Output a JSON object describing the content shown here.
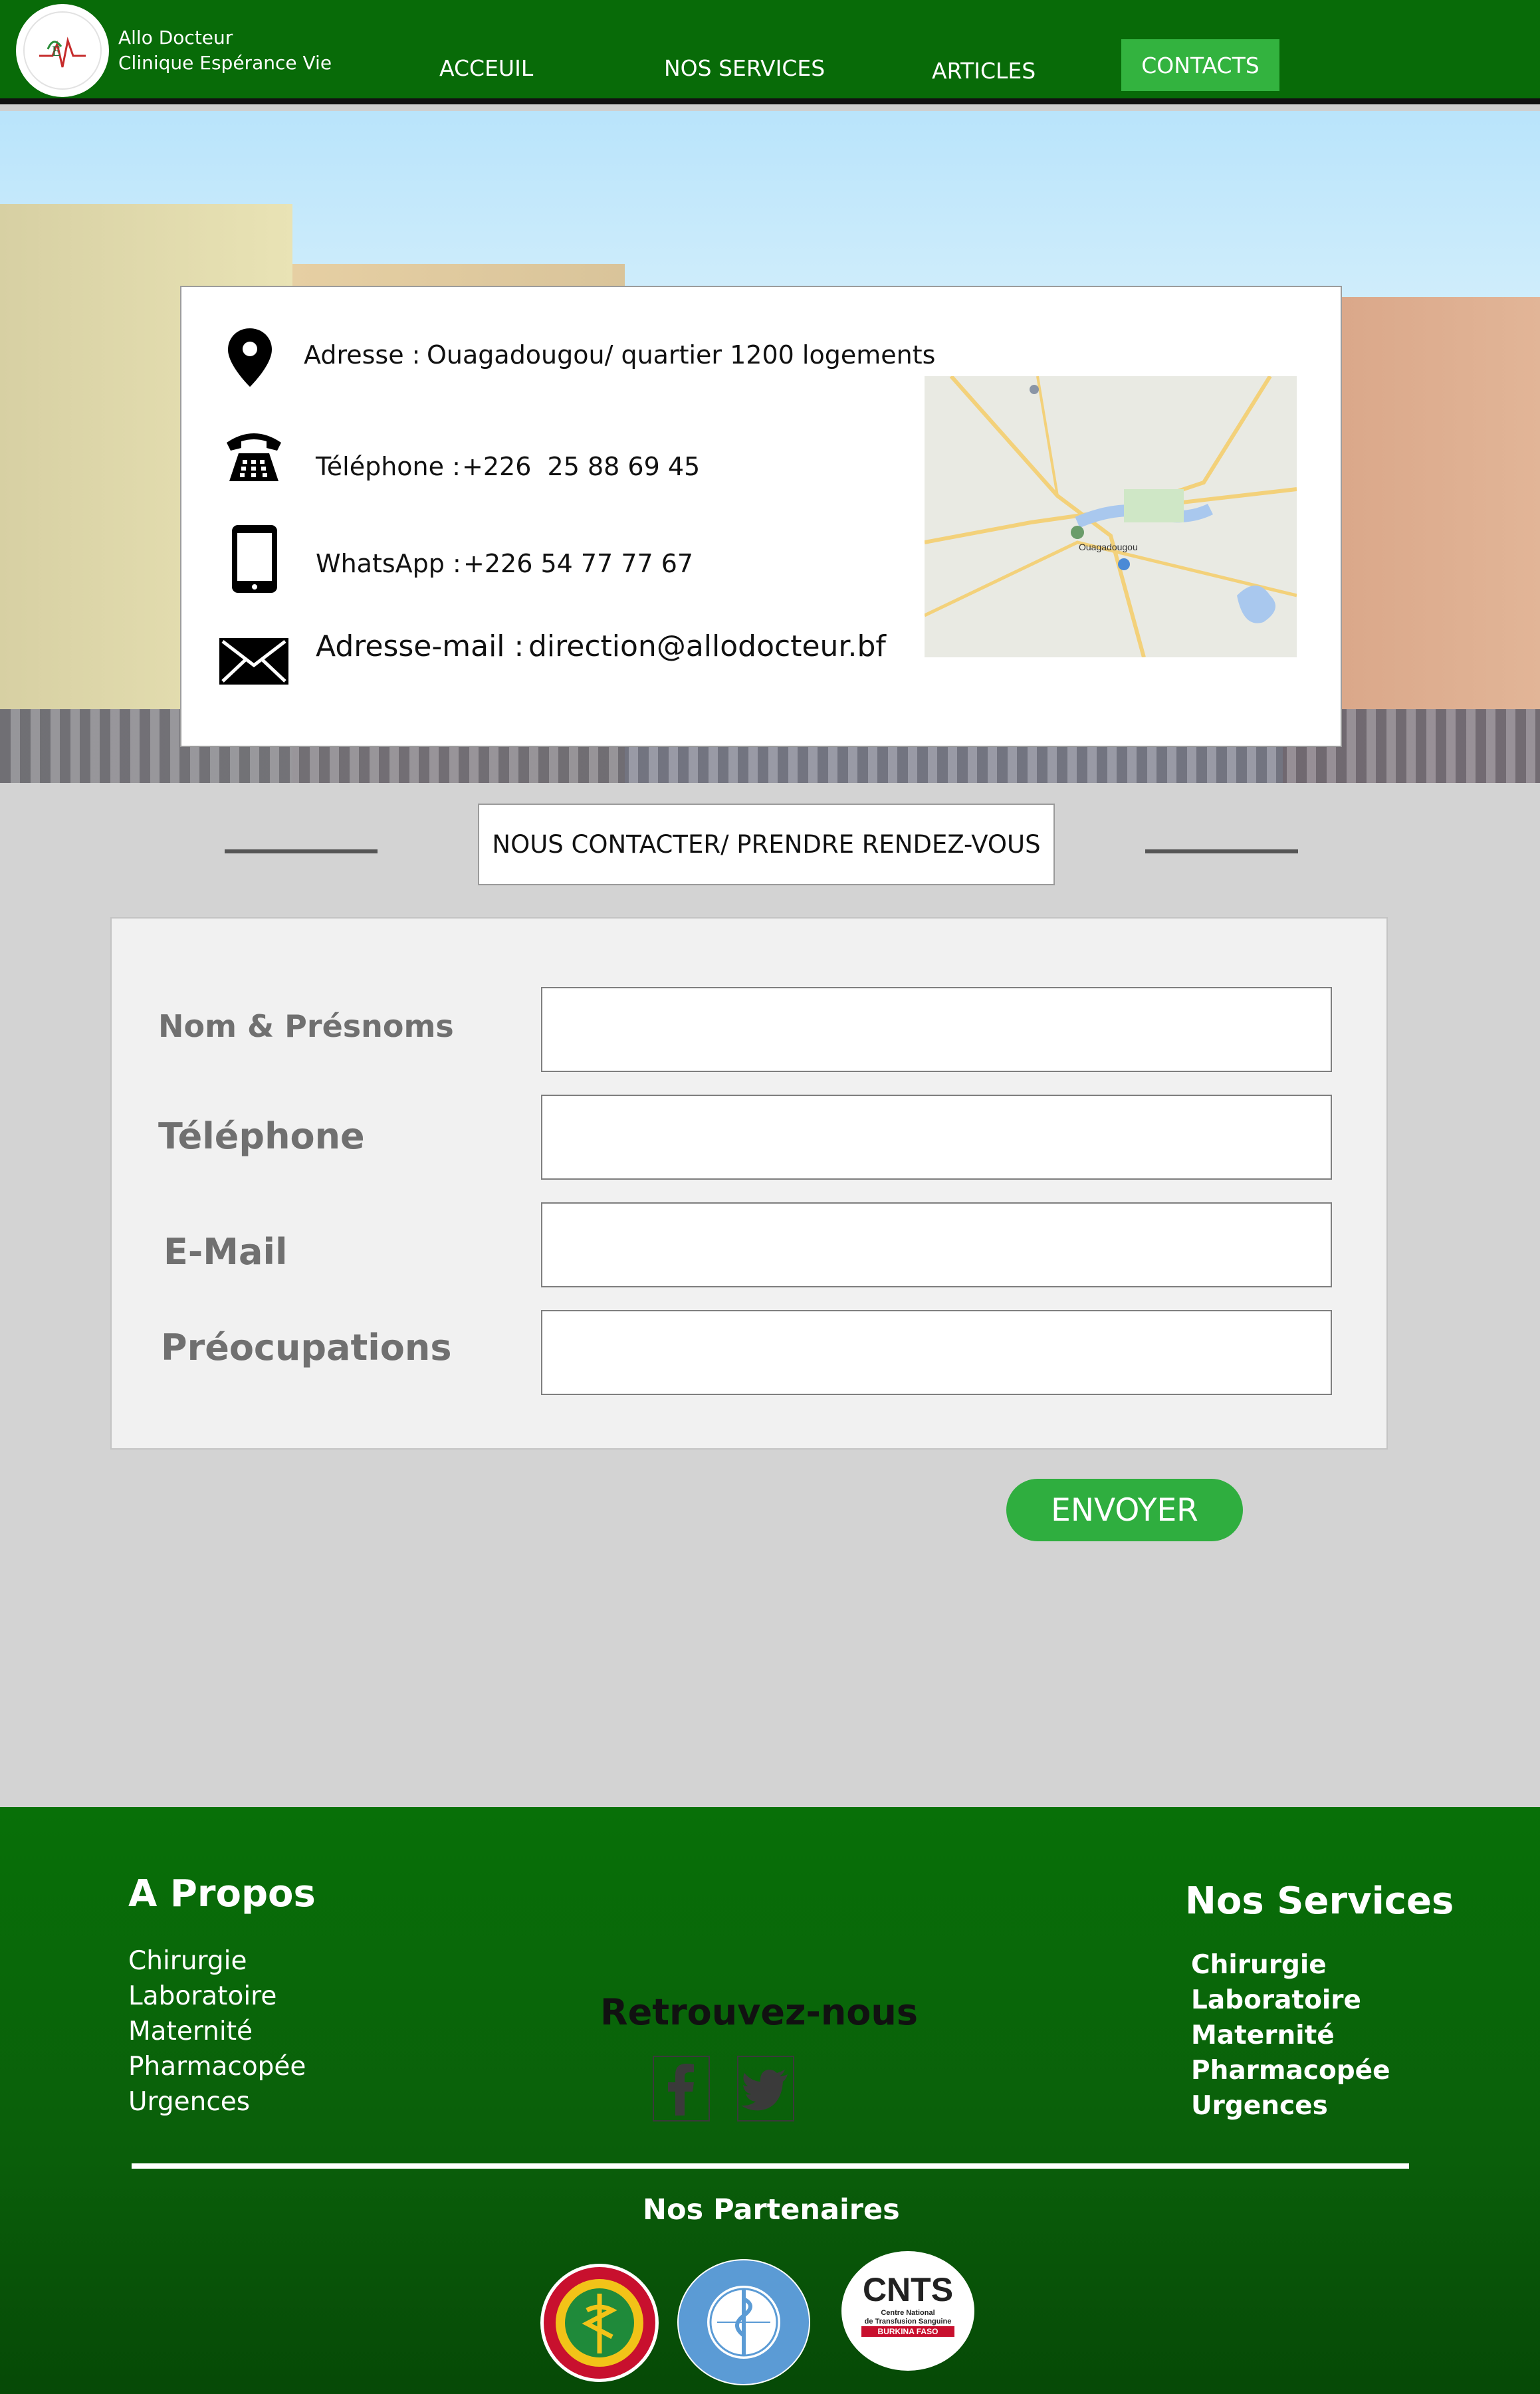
{
  "brand": {
    "name_line1": "Allo Docteur",
    "name_line2": "Clinique Espérance Vie"
  },
  "nav": {
    "items": [
      "ACCEUIL",
      "NOS SERVICES",
      "ARTICLES",
      "CONTACTS"
    ],
    "active": "CONTACTS",
    "active_color": "#33b33f"
  },
  "contact_info": {
    "address_label": "Adresse :",
    "address_value": "Ouagadougou/ quartier 1200 logements",
    "phone_label": "Téléphone :",
    "phone_value": "+226  25 88 69 45",
    "whatsapp_label": "WhatsApp :",
    "whatsapp_value": "+226 54 77 77 67",
    "email_label": "Adresse-mail :",
    "email_value": "direction@allodocteur.bf"
  },
  "map": {
    "city_label": "Ouagadougou"
  },
  "section_title": "NOUS CONTACTER/ PRENDRE RENDEZ-VOUS",
  "form": {
    "fields": [
      {
        "label": "Nom & Présnoms",
        "value": ""
      },
      {
        "label": "Téléphone",
        "value": ""
      },
      {
        "label": "E-Mail",
        "value": ""
      },
      {
        "label": "Préocupations",
        "value": ""
      }
    ],
    "submit_label": "ENVOYER",
    "submit_color": "#2fae3f"
  },
  "footer": {
    "about_title": "A Propos",
    "about_items": [
      "Chirurgie",
      "Laboratoire",
      "Maternité",
      "Pharmacopée",
      "Urgences"
    ],
    "social_title": "Retrouvez-nous",
    "social_icons": [
      "facebook-icon",
      "twitter-icon"
    ],
    "services_title": "Nos Services",
    "services_items": [
      "Chirurgie",
      "Laboratoire",
      "Maternité",
      "Pharmacopée",
      "Urgences"
    ],
    "partners_title": "Nos Partenaires",
    "cnts_logo_text": "CNTS",
    "cnts_sub1": "Centre National",
    "cnts_sub2": "de Transfusion Sanguine",
    "cnts_sub3": "BURKINA FASO",
    "background_color": "#087008"
  }
}
